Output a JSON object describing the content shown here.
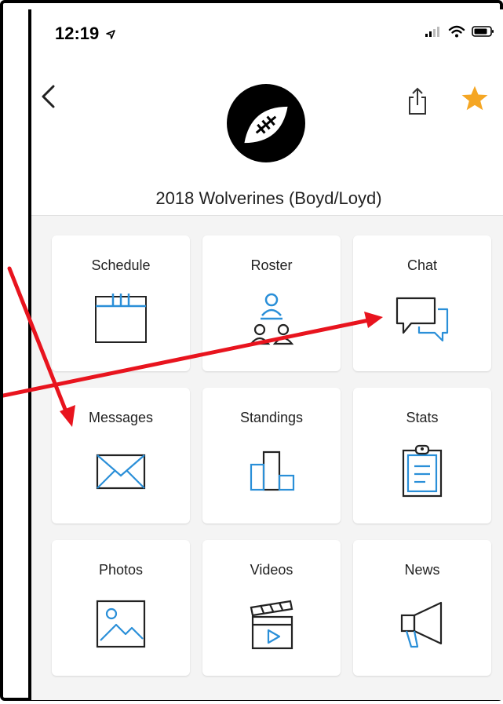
{
  "status": {
    "time": "12:19"
  },
  "header": {
    "team_name": "2018 Wolverines (Boyd/Loyd)"
  },
  "tiles": [
    {
      "label": "Schedule",
      "icon": "calendar-icon"
    },
    {
      "label": "Roster",
      "icon": "roster-icon"
    },
    {
      "label": "Chat",
      "icon": "chat-icon"
    },
    {
      "label": "Messages",
      "icon": "envelope-icon"
    },
    {
      "label": "Standings",
      "icon": "podium-icon"
    },
    {
      "label": "Stats",
      "icon": "clipboard-icon"
    },
    {
      "label": "Photos",
      "icon": "photo-icon"
    },
    {
      "label": "Videos",
      "icon": "clapperboard-icon"
    },
    {
      "label": "News",
      "icon": "megaphone-icon"
    }
  ],
  "colors": {
    "accent": "#2a8fd8",
    "star": "#f5a623",
    "annotation": "#e8141e"
  }
}
